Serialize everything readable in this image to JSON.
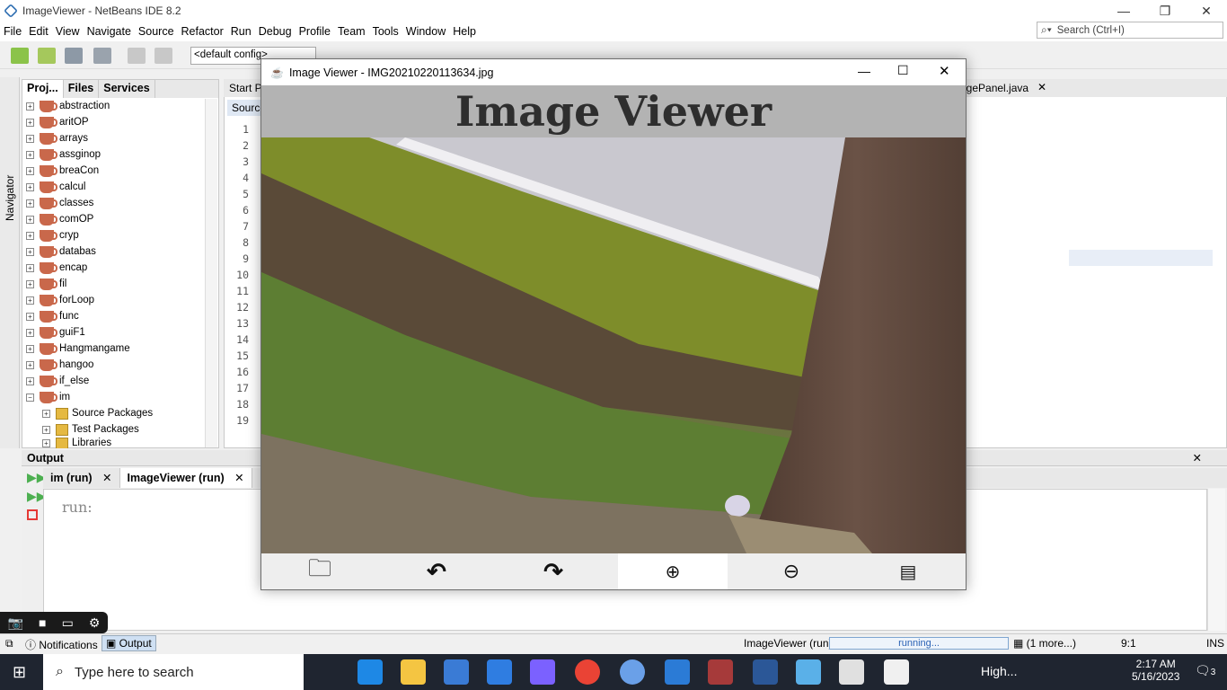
{
  "ide": {
    "window_title": "ImageViewer - NetBeans IDE 8.2",
    "menu": [
      "File",
      "Edit",
      "View",
      "Navigate",
      "Source",
      "Refactor",
      "Run",
      "Debug",
      "Profile",
      "Team",
      "Tools",
      "Window",
      "Help"
    ],
    "search_placeholder": "Search (Ctrl+I)",
    "config": "<default config>",
    "navigator_label": "Navigator",
    "project_tabs": [
      "Proj...",
      "Files",
      "Services"
    ],
    "projects": [
      "abstraction",
      "aritOP",
      "arrays",
      "assginop",
      "breaCon",
      "calcul",
      "classes",
      "comOP",
      "cryp",
      "databas",
      "encap",
      "fil",
      "forLoop",
      "func",
      "guiF1",
      "Hangmangame",
      "hangoo",
      "if_else",
      "im"
    ],
    "im_children": [
      "Source Packages",
      "Test Packages",
      "Libraries"
    ],
    "editor_tab_left": "Start P",
    "editor_tab_right": "agePanel.java",
    "source_tab": "Source",
    "line_numbers": [
      "1",
      "2",
      "3",
      "4",
      "5",
      "6",
      "7",
      "8",
      "9",
      "10",
      "11",
      "12",
      "13",
      "14",
      "15",
      "16",
      "17",
      "18",
      "19"
    ],
    "output_title": "Output",
    "output_tabs": [
      "im (run)",
      "ImageViewer (run)"
    ],
    "output_text": "run:",
    "status": {
      "notifications": "Notifications",
      "output": "Output",
      "task": "ImageViewer (run)",
      "progress_text": "running...",
      "more": "(1 more...)",
      "position": "9:1",
      "mode": "INS"
    }
  },
  "viewer": {
    "window_title": "Image Viewer - IMG20210220113634.jpg",
    "heading": "Image Viewer",
    "toolbar": [
      {
        "icon": "folder-open-icon",
        "glyph": "🗀"
      },
      {
        "icon": "rotate-left-icon",
        "glyph": "↶"
      },
      {
        "icon": "rotate-right-icon",
        "glyph": "↷"
      },
      {
        "icon": "zoom-in-icon",
        "glyph": "🔍"
      },
      {
        "icon": "zoom-out-icon",
        "glyph": "🔍"
      },
      {
        "icon": "gallery-icon",
        "glyph": "🖼"
      }
    ]
  },
  "taskbar": {
    "search_placeholder": "Type here to search",
    "weather": "High...",
    "time": "2:17 AM",
    "date": "5/16/2023",
    "notif_count": "3"
  }
}
